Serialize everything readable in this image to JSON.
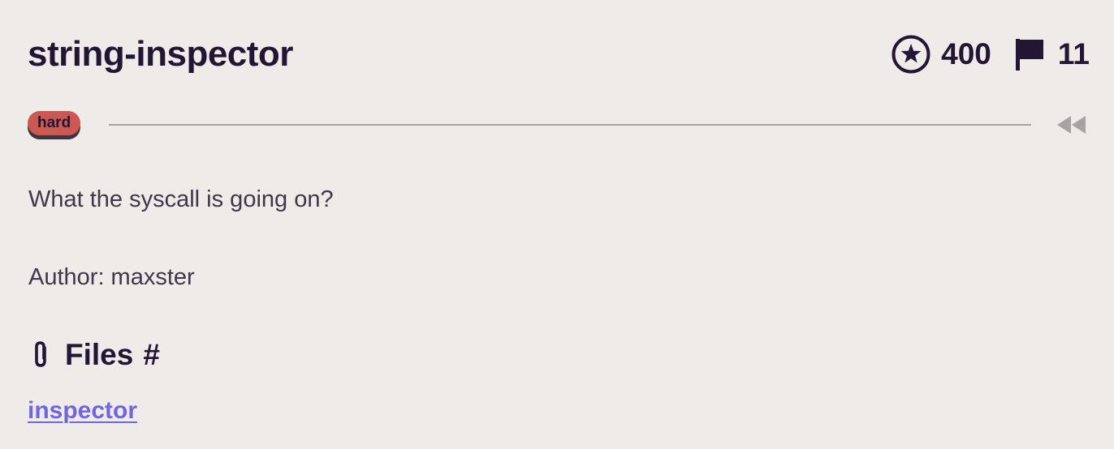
{
  "challenge": {
    "title": "string-inspector",
    "points": "400",
    "solves": "11",
    "difficulty": "hard",
    "description": "What the syscall is going on?",
    "author_line": "Author: maxster"
  },
  "files": {
    "heading": "Files",
    "anchor": "#",
    "items": [
      {
        "name": "inspector"
      }
    ]
  },
  "icons": {
    "points": "star-circle-icon",
    "solves": "flag-icon",
    "collapse": "double-chevron-left-icon",
    "files": "paperclip-icon"
  },
  "colors": {
    "background": "#efebe8",
    "text": "#231634",
    "badge": "#cb5853",
    "link": "#7266dd"
  }
}
